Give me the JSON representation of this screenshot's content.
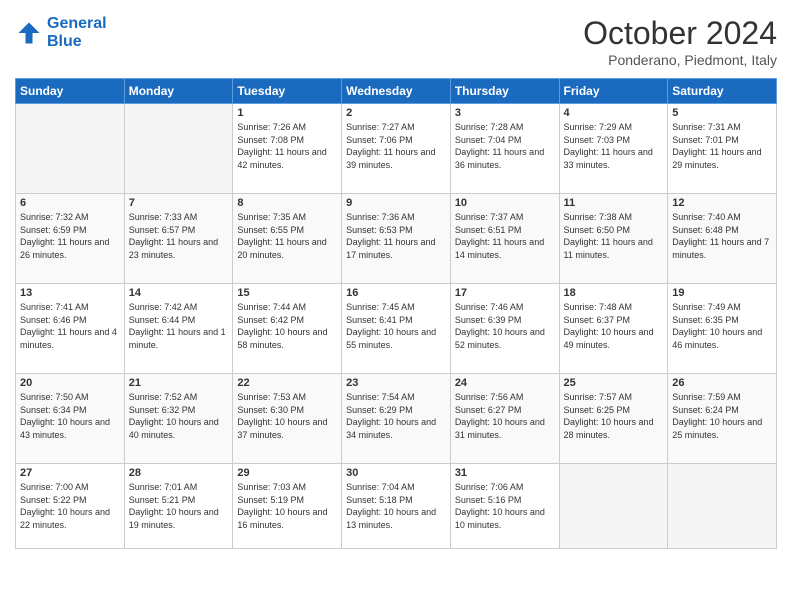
{
  "header": {
    "logo_line1": "General",
    "logo_line2": "Blue",
    "month_title": "October 2024",
    "location": "Ponderano, Piedmont, Italy"
  },
  "days_of_week": [
    "Sunday",
    "Monday",
    "Tuesday",
    "Wednesday",
    "Thursday",
    "Friday",
    "Saturday"
  ],
  "weeks": [
    [
      {
        "num": "",
        "info": ""
      },
      {
        "num": "",
        "info": ""
      },
      {
        "num": "1",
        "info": "Sunrise: 7:26 AM\nSunset: 7:08 PM\nDaylight: 11 hours and 42 minutes."
      },
      {
        "num": "2",
        "info": "Sunrise: 7:27 AM\nSunset: 7:06 PM\nDaylight: 11 hours and 39 minutes."
      },
      {
        "num": "3",
        "info": "Sunrise: 7:28 AM\nSunset: 7:04 PM\nDaylight: 11 hours and 36 minutes."
      },
      {
        "num": "4",
        "info": "Sunrise: 7:29 AM\nSunset: 7:03 PM\nDaylight: 11 hours and 33 minutes."
      },
      {
        "num": "5",
        "info": "Sunrise: 7:31 AM\nSunset: 7:01 PM\nDaylight: 11 hours and 29 minutes."
      }
    ],
    [
      {
        "num": "6",
        "info": "Sunrise: 7:32 AM\nSunset: 6:59 PM\nDaylight: 11 hours and 26 minutes."
      },
      {
        "num": "7",
        "info": "Sunrise: 7:33 AM\nSunset: 6:57 PM\nDaylight: 11 hours and 23 minutes."
      },
      {
        "num": "8",
        "info": "Sunrise: 7:35 AM\nSunset: 6:55 PM\nDaylight: 11 hours and 20 minutes."
      },
      {
        "num": "9",
        "info": "Sunrise: 7:36 AM\nSunset: 6:53 PM\nDaylight: 11 hours and 17 minutes."
      },
      {
        "num": "10",
        "info": "Sunrise: 7:37 AM\nSunset: 6:51 PM\nDaylight: 11 hours and 14 minutes."
      },
      {
        "num": "11",
        "info": "Sunrise: 7:38 AM\nSunset: 6:50 PM\nDaylight: 11 hours and 11 minutes."
      },
      {
        "num": "12",
        "info": "Sunrise: 7:40 AM\nSunset: 6:48 PM\nDaylight: 11 hours and 7 minutes."
      }
    ],
    [
      {
        "num": "13",
        "info": "Sunrise: 7:41 AM\nSunset: 6:46 PM\nDaylight: 11 hours and 4 minutes."
      },
      {
        "num": "14",
        "info": "Sunrise: 7:42 AM\nSunset: 6:44 PM\nDaylight: 11 hours and 1 minute."
      },
      {
        "num": "15",
        "info": "Sunrise: 7:44 AM\nSunset: 6:42 PM\nDaylight: 10 hours and 58 minutes."
      },
      {
        "num": "16",
        "info": "Sunrise: 7:45 AM\nSunset: 6:41 PM\nDaylight: 10 hours and 55 minutes."
      },
      {
        "num": "17",
        "info": "Sunrise: 7:46 AM\nSunset: 6:39 PM\nDaylight: 10 hours and 52 minutes."
      },
      {
        "num": "18",
        "info": "Sunrise: 7:48 AM\nSunset: 6:37 PM\nDaylight: 10 hours and 49 minutes."
      },
      {
        "num": "19",
        "info": "Sunrise: 7:49 AM\nSunset: 6:35 PM\nDaylight: 10 hours and 46 minutes."
      }
    ],
    [
      {
        "num": "20",
        "info": "Sunrise: 7:50 AM\nSunset: 6:34 PM\nDaylight: 10 hours and 43 minutes."
      },
      {
        "num": "21",
        "info": "Sunrise: 7:52 AM\nSunset: 6:32 PM\nDaylight: 10 hours and 40 minutes."
      },
      {
        "num": "22",
        "info": "Sunrise: 7:53 AM\nSunset: 6:30 PM\nDaylight: 10 hours and 37 minutes."
      },
      {
        "num": "23",
        "info": "Sunrise: 7:54 AM\nSunset: 6:29 PM\nDaylight: 10 hours and 34 minutes."
      },
      {
        "num": "24",
        "info": "Sunrise: 7:56 AM\nSunset: 6:27 PM\nDaylight: 10 hours and 31 minutes."
      },
      {
        "num": "25",
        "info": "Sunrise: 7:57 AM\nSunset: 6:25 PM\nDaylight: 10 hours and 28 minutes."
      },
      {
        "num": "26",
        "info": "Sunrise: 7:59 AM\nSunset: 6:24 PM\nDaylight: 10 hours and 25 minutes."
      }
    ],
    [
      {
        "num": "27",
        "info": "Sunrise: 7:00 AM\nSunset: 5:22 PM\nDaylight: 10 hours and 22 minutes."
      },
      {
        "num": "28",
        "info": "Sunrise: 7:01 AM\nSunset: 5:21 PM\nDaylight: 10 hours and 19 minutes."
      },
      {
        "num": "29",
        "info": "Sunrise: 7:03 AM\nSunset: 5:19 PM\nDaylight: 10 hours and 16 minutes."
      },
      {
        "num": "30",
        "info": "Sunrise: 7:04 AM\nSunset: 5:18 PM\nDaylight: 10 hours and 13 minutes."
      },
      {
        "num": "31",
        "info": "Sunrise: 7:06 AM\nSunset: 5:16 PM\nDaylight: 10 hours and 10 minutes."
      },
      {
        "num": "",
        "info": ""
      },
      {
        "num": "",
        "info": ""
      }
    ]
  ]
}
